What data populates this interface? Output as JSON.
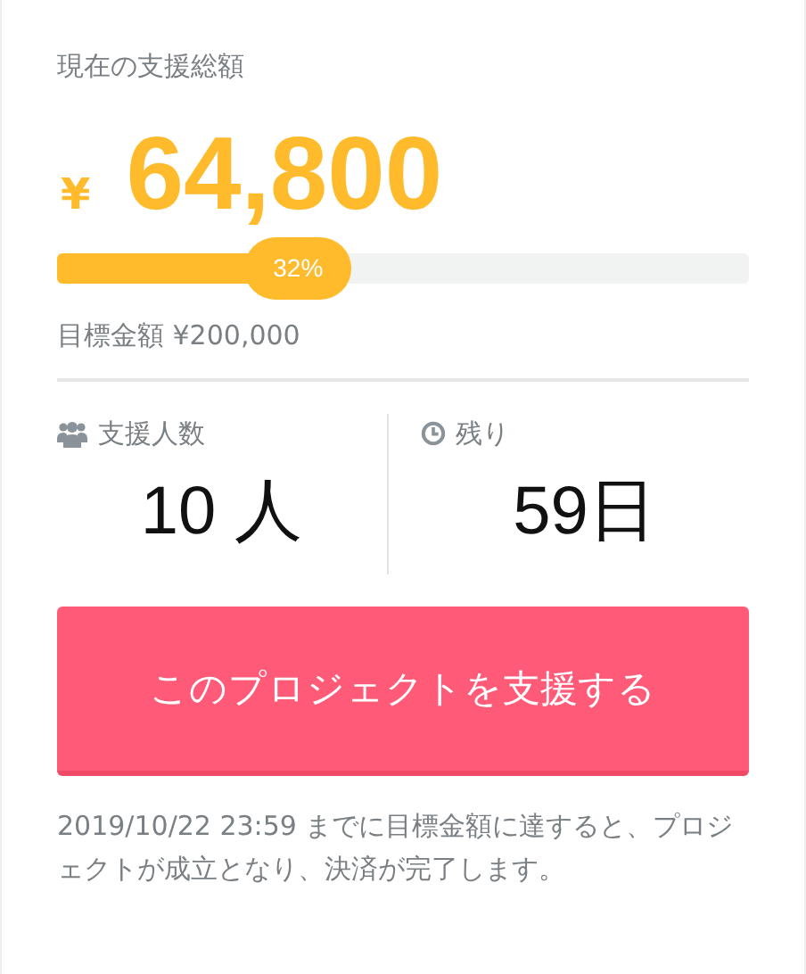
{
  "total_label": "現在の支援総額",
  "amount": {
    "currency": "¥",
    "value": "64,800"
  },
  "progress": {
    "level": 0.32,
    "label": "32%"
  },
  "goal": "目標金額 ¥200,000",
  "stats": [
    {
      "kind": "people",
      "label": "支援人数",
      "value": "10 人"
    },
    {
      "kind": "time",
      "label": "残り",
      "value": "59日"
    }
  ],
  "button": "このプロジェクトを支援する",
  "note": "2019/10/22 23:59 までに目標金額に達すると、プロジェクトが成立となり、決済が完了します。"
}
